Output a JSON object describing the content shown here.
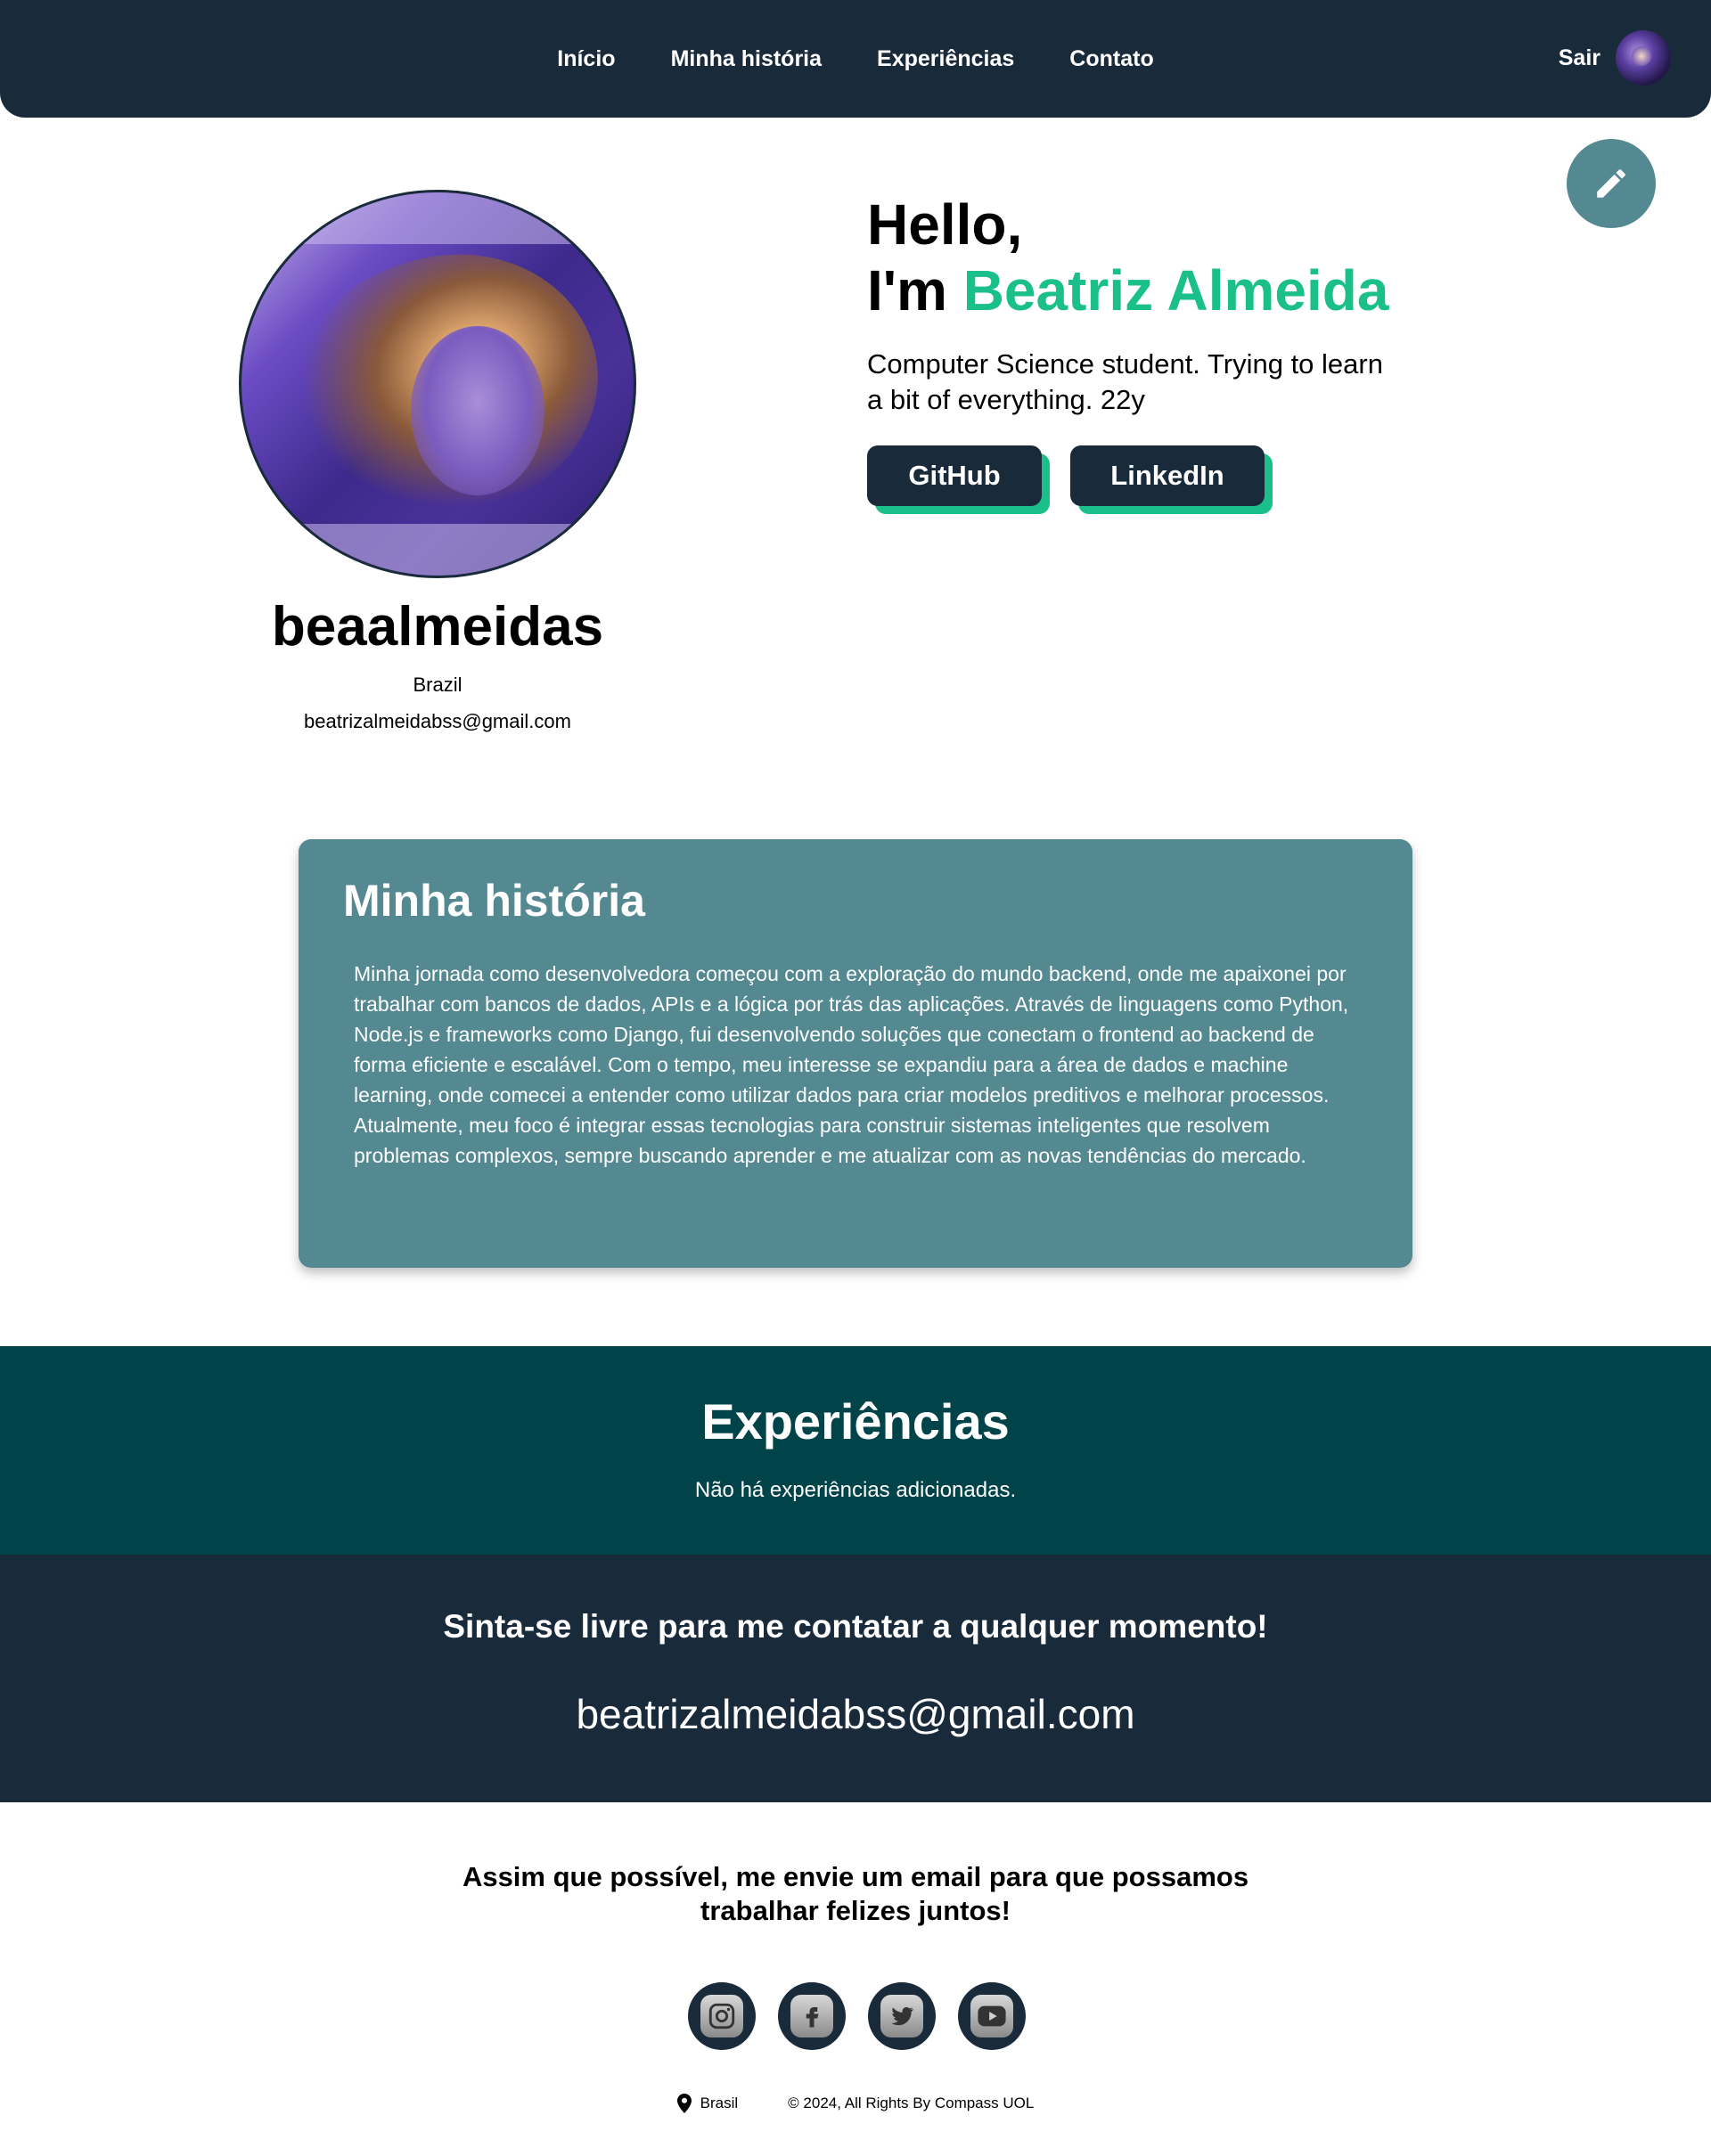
{
  "nav": {
    "links": [
      "Início",
      "Minha história",
      "Experiências",
      "Contato"
    ],
    "logout": "Sair"
  },
  "profile": {
    "username": "beaalmeidas",
    "country": "Brazil",
    "email": "beatrizalmeidabss@gmail.com"
  },
  "hero": {
    "hello": "Hello,",
    "im": "I'm ",
    "name": "Beatriz Almeida",
    "tagline": "Computer Science student. Trying to learn a bit of everything. 22y",
    "github_label": "GitHub",
    "linkedin_label": "LinkedIn",
    "accent_color": "#1bbf8a"
  },
  "story": {
    "title": "Minha história",
    "text": "Minha jornada como desenvolvedora começou com a exploração do mundo backend, onde me apaixonei por trabalhar com bancos de dados, APIs e a lógica por trás das aplicações. Através de linguagens como Python, Node.js e frameworks como Django, fui desenvolvendo soluções que conectam o frontend ao backend de forma eficiente e escalável. Com o tempo, meu interesse se expandiu para a área de dados e machine learning, onde comecei a entender como utilizar dados para criar modelos preditivos e melhorar processos. Atualmente, meu foco é integrar essas tecnologias para construir sistemas inteligentes que resolvem problemas complexos, sempre buscando aprender e me atualizar com as novas tendências do mercado."
  },
  "experiences": {
    "title": "Experiências",
    "empty_text": "Não há experiências adicionadas."
  },
  "contact": {
    "title": "Sinta-se livre para me contatar a qualquer momento!",
    "email": "beatrizalmeidabss@gmail.com"
  },
  "footer": {
    "message": "Assim que possível, me envie um email para que possamos trabalhar felizes juntos!",
    "social_icons": [
      "instagram-icon",
      "facebook-icon",
      "twitter-icon",
      "youtube-icon"
    ],
    "location": "Brasil",
    "copyright": "© 2024, All Rights By Compass UOL"
  },
  "colors": {
    "navy": "#192a3b",
    "teal": "#548991",
    "dark_teal": "#004349",
    "accent": "#1bbf8a"
  }
}
